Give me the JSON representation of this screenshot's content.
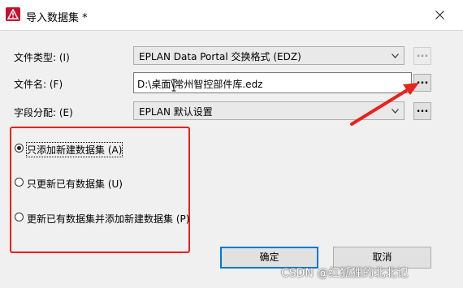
{
  "window": {
    "title": "导入数据集 *",
    "icon": "eplan-warning-logo-icon",
    "close_icon": "close-icon",
    "brand_color": "#c8102e"
  },
  "form": {
    "file_type_label": "文件类型: (I)",
    "file_type_value": "EPLAN Data Portal 交换格式 (EDZ)",
    "file_name_label": "文件名: (F)",
    "file_name_value": "D:\\桌面\\常州智控部件库.edz",
    "field_assign_label": "字段分配: (E)",
    "field_assign_value": "EPLAN 默认设置",
    "browse_label": "..."
  },
  "options": [
    {
      "label": "只添加新建数据集 (A)",
      "checked": true
    },
    {
      "label": "只更新已有数据集 (U)",
      "checked": false
    },
    {
      "label": "更新已有数据集并添加新建数据集 (P)",
      "checked": false
    }
  ],
  "buttons": {
    "ok": "确定",
    "cancel": "取消"
  },
  "annotation": {
    "highlight_color": "#e8221d"
  },
  "watermark": "CSDN @红狐狸的北北记"
}
